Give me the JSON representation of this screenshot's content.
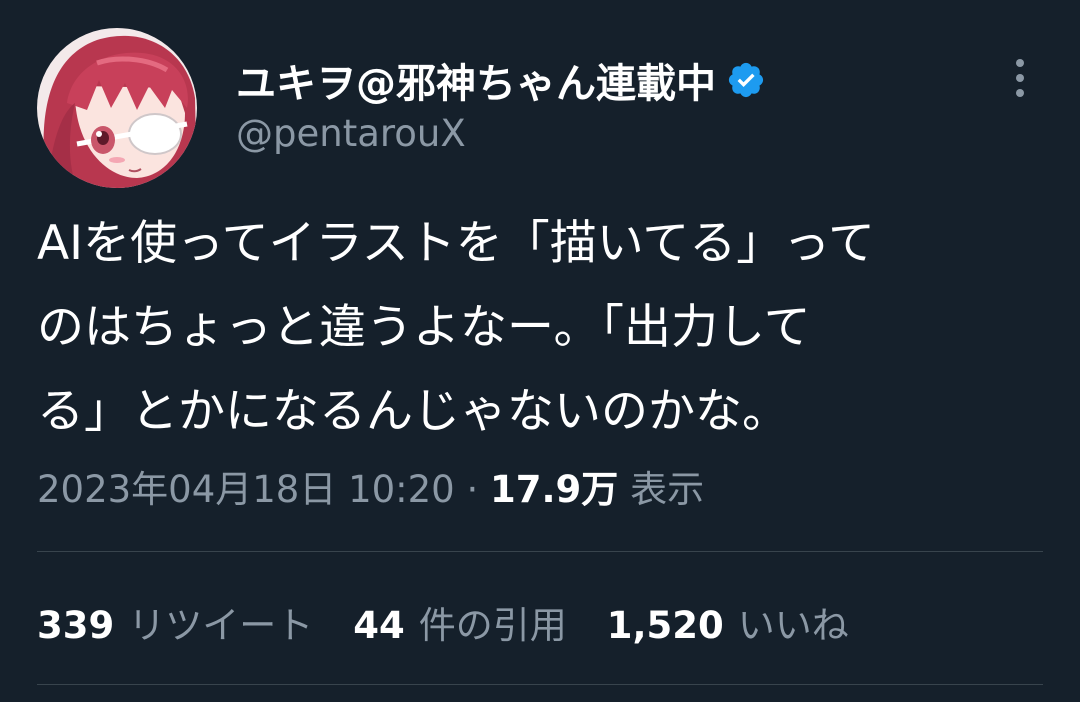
{
  "tweet": {
    "author": {
      "display_name": "ユキヲ@邪神ちゃん連載中",
      "handle": "@pentarouX",
      "verified": true,
      "verified_icon": "verified-badge-icon",
      "avatar": "anime-avatar-illustration"
    },
    "more_icon": "vertical-ellipsis-icon",
    "text_lines": [
      "AIを使ってイラストを「描いてる」って",
      "のはちょっと違うよなー。「出力して",
      "る」とかになるんじゃないのかな。"
    ],
    "timestamp": "2023年04月18日 10:20",
    "separator": "·",
    "views_count": "17.9万",
    "views_label": "表示",
    "stats": {
      "retweets_count": "339",
      "retweets_label": "リツイート",
      "quotes_count": "44",
      "quotes_label": "件の引用",
      "likes_count": "1,520",
      "likes_label": "いいね"
    }
  },
  "colors": {
    "background": "#15202b",
    "primary_text": "#ffffff",
    "secondary_text": "#8b98a5",
    "divider": "#38444d",
    "verified_blue": "#1d9bf0"
  }
}
